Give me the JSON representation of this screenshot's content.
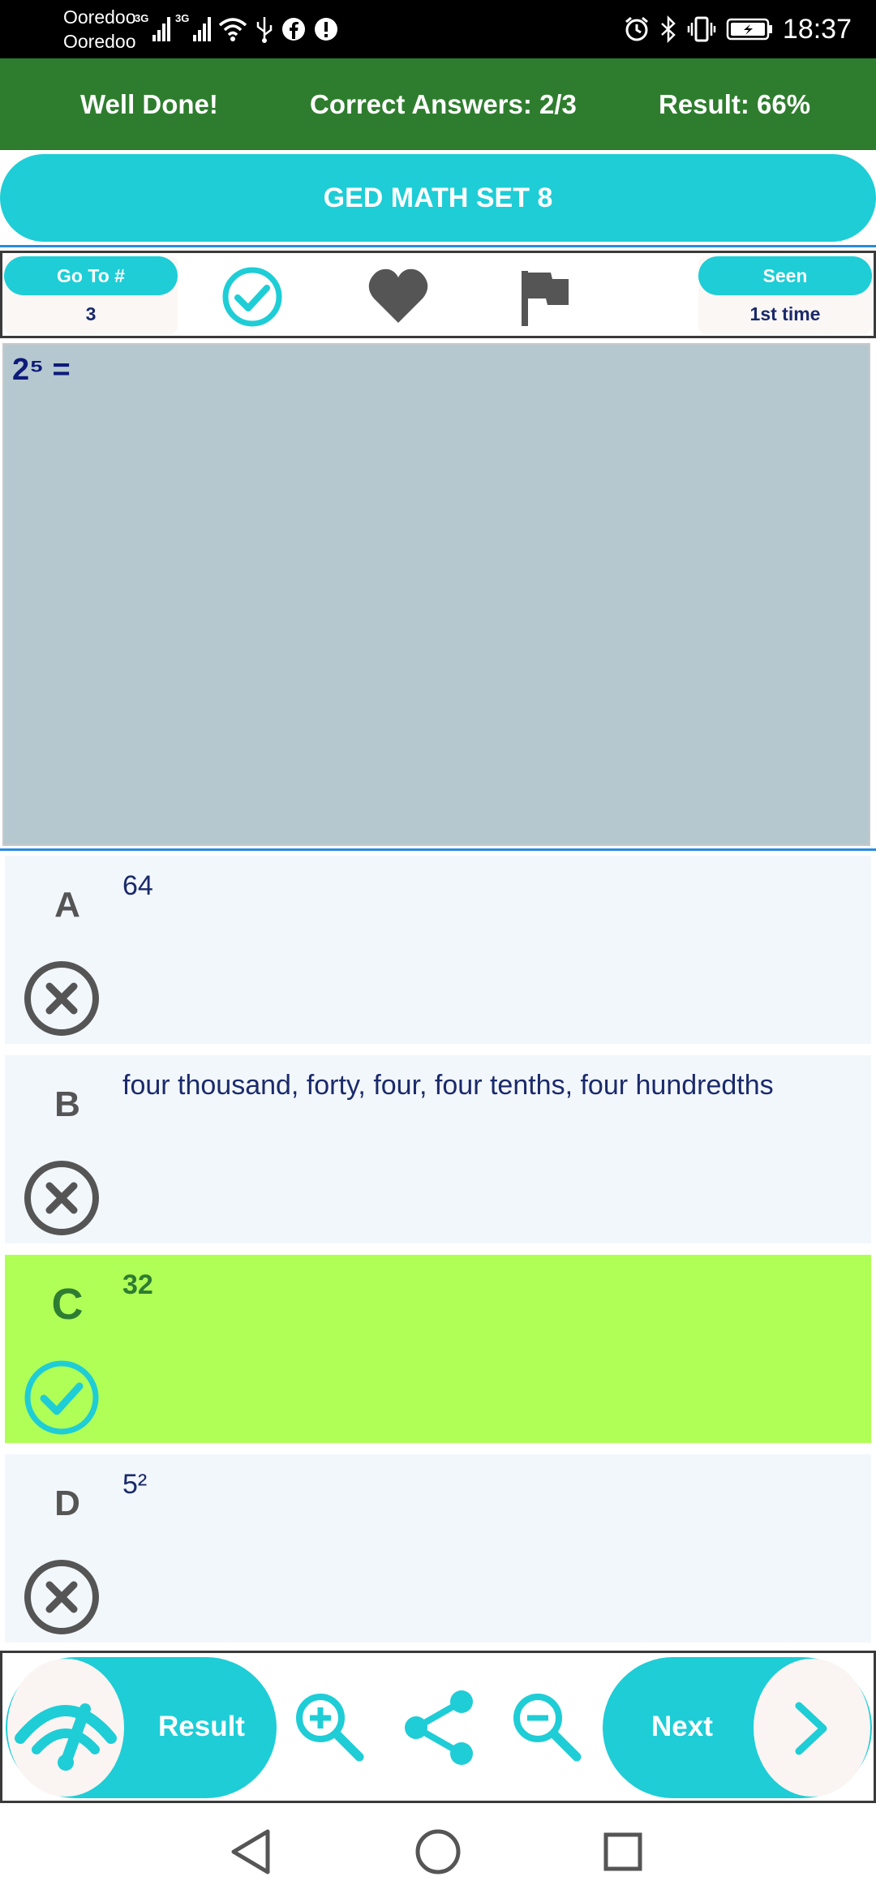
{
  "status_bar": {
    "carrier_1": "Ooredoo",
    "carrier_2": "Ooredoo",
    "network_1": "3G",
    "network_2": "3G",
    "time": "18:37"
  },
  "banner": {
    "message": "Well Done!",
    "correct_answers": "Correct Answers: 2/3",
    "result": "Result: 66%"
  },
  "header": {
    "title": "GED MATH SET 8"
  },
  "toolbar": {
    "goto_label": "Go To #",
    "goto_value": "3",
    "seen_label": "Seen",
    "seen_value": "1st time"
  },
  "question": {
    "text": "2⁵ ="
  },
  "options": [
    {
      "letter": "A",
      "text": "64",
      "status": "wrong"
    },
    {
      "letter": "B",
      "text": "four thousand, forty, four, four tenths, four hundredths",
      "status": "wrong"
    },
    {
      "letter": "C",
      "text": "32",
      "status": "correct"
    },
    {
      "letter": "D",
      "text": "5²",
      "status": "wrong"
    }
  ],
  "action_bar": {
    "result_label": "Result",
    "next_label": "Next"
  },
  "colors": {
    "accent": "#1ecdd6",
    "banner_green": "#2e7d2e",
    "correct_bg": "#b0ff57",
    "icon_gray": "#555555"
  }
}
